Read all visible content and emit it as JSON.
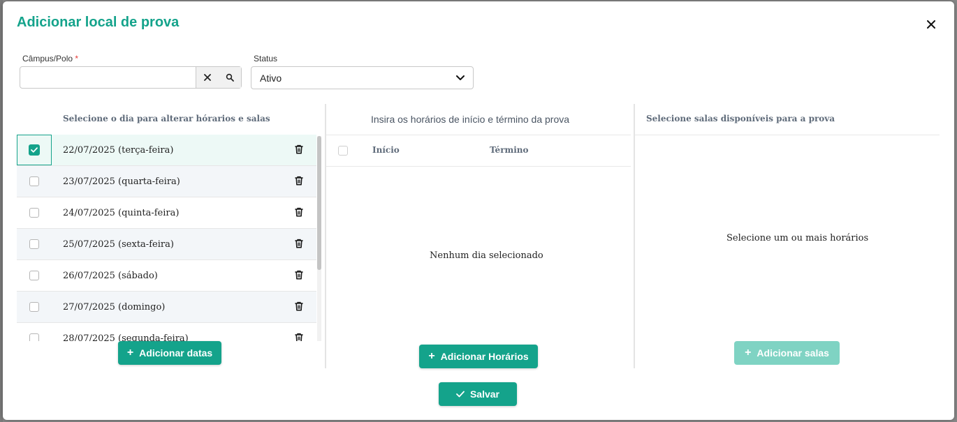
{
  "dialog": {
    "title": "Adicionar local de prova"
  },
  "form": {
    "campus_label": "Câmpus/Polo",
    "campus_required": "*",
    "campus_value": "",
    "status_label": "Status",
    "status_value": "Ativo"
  },
  "days_panel": {
    "header": "Selecione o dia para alterar hórarios e salas",
    "rows": [
      {
        "label": "22/07/2025 (terça-feira)",
        "checked": true
      },
      {
        "label": "23/07/2025 (quarta-feira)",
        "checked": false
      },
      {
        "label": "24/07/2025 (quinta-feira)",
        "checked": false
      },
      {
        "label": "25/07/2025 (sexta-feira)",
        "checked": false
      },
      {
        "label": "26/07/2025 (sábado)",
        "checked": false
      },
      {
        "label": "27/07/2025 (domingo)",
        "checked": false
      },
      {
        "label": "28/07/2025 (segunda-feira)",
        "checked": false
      }
    ],
    "add_button": "Adicionar datas"
  },
  "times_panel": {
    "header": "Insira os horários de início e término da prova",
    "col_start": "Início",
    "col_end": "Término",
    "empty": "Nenhum dia selecionado",
    "add_button": "Adicionar Horários"
  },
  "rooms_panel": {
    "header": "Selecione salas disponíveis para a prova",
    "empty": "Selecione um ou mais horários",
    "add_button": "Adicionar salas"
  },
  "footer": {
    "save_button": "Salvar"
  },
  "colors": {
    "accent": "#14a38b",
    "accent_disabled": "#7fd3c3",
    "required": "#e53935"
  },
  "icons": {
    "close": "close-icon",
    "clear": "clear-icon",
    "search": "search-icon",
    "chevron": "chevron-down-icon",
    "trash": "trash-icon",
    "check": "check-icon",
    "plus": "plus-icon"
  }
}
